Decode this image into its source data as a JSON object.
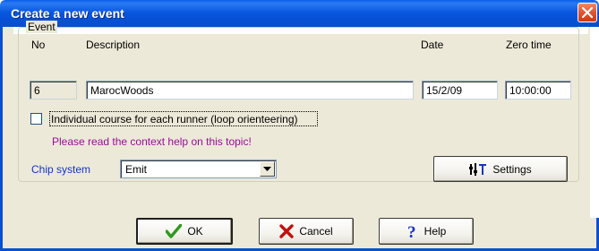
{
  "window": {
    "title": "Create a new event"
  },
  "event_group": {
    "legend": "Event",
    "no_label": "No",
    "no_value": "6",
    "description_label": "Description",
    "description_value": "MarocWoods",
    "date_label": "Date",
    "date_value": "15/2/09",
    "zero_time_label": "Zero time",
    "zero_time_value": "10:00:00",
    "individual_course_checkbox": {
      "label": "Individual course for each runner (loop orienteering)",
      "checked": false
    },
    "help_hint": "Please read the context help on this topic!",
    "chip_system_label": "Chip system",
    "chip_system_value": "Emit",
    "settings_button_label": "Settings"
  },
  "buttons": {
    "ok_label": "OK",
    "cancel_label": "Cancel",
    "help_label": "Help"
  },
  "colors": {
    "titlebar": "#0a58e0",
    "dialog_bg": "#ece9d8",
    "hint_text": "#9a0c9a",
    "chip_label": "#1434c8",
    "close_button": "#e25530"
  },
  "icons": {
    "close": "close-icon",
    "ok": "checkmark-icon",
    "cancel": "x-icon",
    "help": "question-mark-icon",
    "settings": "settings-icon",
    "dropdown": "chevron-down-icon"
  }
}
